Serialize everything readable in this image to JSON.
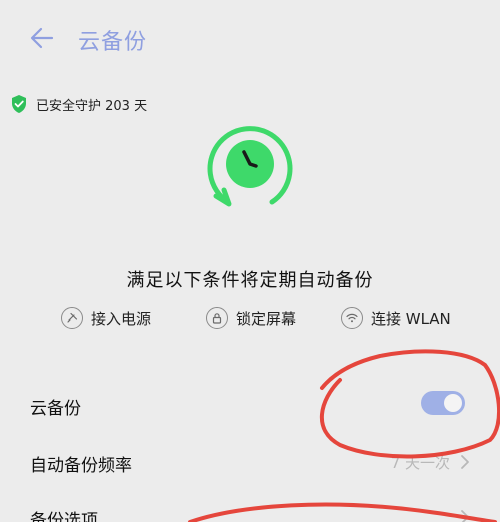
{
  "header": {
    "title": "云备份"
  },
  "protection": {
    "text": "已安全守护 203 天"
  },
  "conditions": {
    "title": "满足以下条件将定期自动备份",
    "items": [
      {
        "label": "接入电源",
        "icon": "power-plug-icon"
      },
      {
        "label": "锁定屏幕",
        "icon": "lock-icon"
      },
      {
        "label": "连接 WLAN",
        "icon": "wifi-icon"
      }
    ]
  },
  "settings": {
    "cloud_backup": {
      "label": "云备份",
      "enabled": true
    },
    "frequency": {
      "label": "自动备份频率",
      "value": "7 天一次"
    },
    "options": {
      "label": "备份选项"
    }
  },
  "colors": {
    "accent": "#8f9fe0",
    "toggle_on": "#9fb0e6",
    "clock_green": "#3ed96a",
    "shield_green": "#2fbf5a",
    "annotation_red": "#e5463c"
  }
}
